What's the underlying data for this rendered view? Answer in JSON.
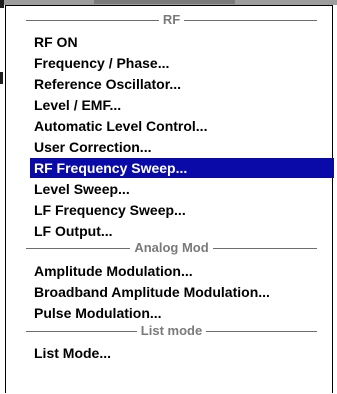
{
  "menu": {
    "sections": [
      {
        "label": "RF"
      },
      {
        "label": "Analog Mod"
      },
      {
        "label": "List mode"
      }
    ],
    "items": [
      {
        "label": "RF ON"
      },
      {
        "label": "Frequency / Phase..."
      },
      {
        "label": "Reference Oscillator..."
      },
      {
        "label": "Level / EMF..."
      },
      {
        "label": "Automatic Level Control..."
      },
      {
        "label": "User Correction..."
      },
      {
        "label": "RF Frequency Sweep...",
        "selected": true
      },
      {
        "label": "Level Sweep..."
      },
      {
        "label": "LF Frequency Sweep..."
      },
      {
        "label": "LF Output..."
      },
      {
        "label": "Amplitude Modulation..."
      },
      {
        "label": "Broadband Amplitude Modulation..."
      },
      {
        "label": "Pulse Modulation..."
      },
      {
        "label": "List Mode..."
      }
    ]
  },
  "colors": {
    "highlight": "#0a0aa8",
    "separator_text": "#7a7a7a"
  }
}
